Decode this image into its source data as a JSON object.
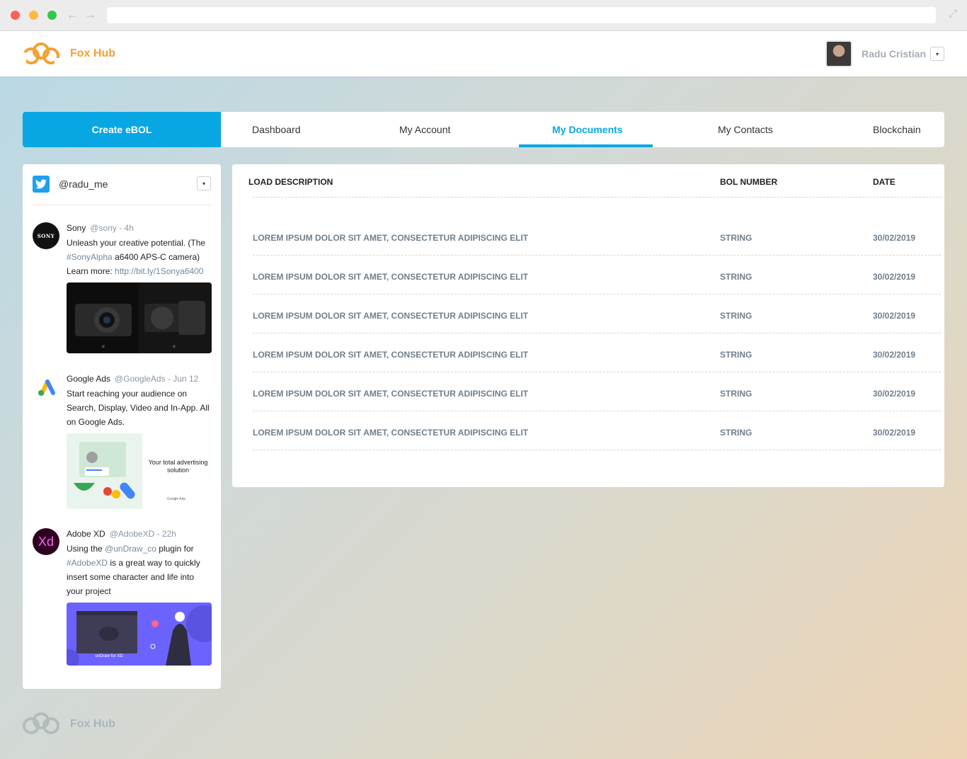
{
  "app": {
    "brand": "Fox Hub",
    "accent_color": "#08a7e4",
    "brand_color": "#f5a031"
  },
  "browser": {
    "back_icon": "←",
    "forward_icon": "→",
    "expand_icon": "⤢"
  },
  "user": {
    "name": "Radu Cristian",
    "menu_icon": "▾"
  },
  "tabs": {
    "create": "Create eBOL",
    "items": [
      {
        "label": "Dashboard"
      },
      {
        "label": "My Account"
      },
      {
        "label": "My Documents"
      },
      {
        "label": "My Contacts"
      },
      {
        "label": "Blockchain"
      }
    ]
  },
  "twitter": {
    "handle": "@radu_me",
    "menu_icon": "▾",
    "tweets": [
      {
        "name": "Sony",
        "meta": "@sony - 4h",
        "avatar_text": "SONY",
        "text_a": "Unleash your creative potential. (The",
        "tag": "#SonyAlpha",
        "text_b": "a6400 APS-C camera)",
        "text_c": "Learn more:",
        "link": "http://bit.ly/1Sonya6400"
      },
      {
        "name": "Google Ads",
        "meta": "@GoogleAds - Jun 12",
        "text": "Start reaching your audience on Search, Display, Video and In-App. All on Google Ads.",
        "media_caption": "Your total advertising solution",
        "media_logo": "Google Ads"
      },
      {
        "name": "Adobe XD",
        "meta": "@AdobeXD - 22h",
        "avatar_text": "Xd",
        "text_a": "Using the",
        "mention": "@unDraw_co",
        "text_b": "plugin for",
        "tag": "#AdobeXD",
        "text_c": "is a great way to quickly insert some character and life into your project",
        "media_caption": "unDraw for XD"
      }
    ]
  },
  "documents": {
    "columns": {
      "description": "LOAD DESCRIPTION",
      "bol": "BOL NUMBER",
      "date": "DATE"
    },
    "rows": [
      {
        "description": "LOREM IPSUM DOLOR SIT AMET, CONSECTETUR ADIPISCING ELIT",
        "bol": "STRING",
        "date": "30/02/2019"
      },
      {
        "description": "LOREM IPSUM DOLOR SIT AMET, CONSECTETUR ADIPISCING ELIT",
        "bol": "STRING",
        "date": "30/02/2019"
      },
      {
        "description": "LOREM IPSUM DOLOR SIT AMET, CONSECTETUR ADIPISCING ELIT",
        "bol": "STRING",
        "date": "30/02/2019"
      },
      {
        "description": "LOREM IPSUM DOLOR SIT AMET, CONSECTETUR ADIPISCING ELIT",
        "bol": "STRING",
        "date": "30/02/2019"
      },
      {
        "description": "LOREM IPSUM DOLOR SIT AMET, CONSECTETUR ADIPISCING ELIT",
        "bol": "STRING",
        "date": "30/02/2019"
      },
      {
        "description": "LOREM IPSUM DOLOR SIT AMET, CONSECTETUR ADIPISCING ELIT",
        "bol": "STRING",
        "date": "30/02/2019"
      }
    ]
  },
  "footer": {
    "brand": "Fox Hub"
  }
}
